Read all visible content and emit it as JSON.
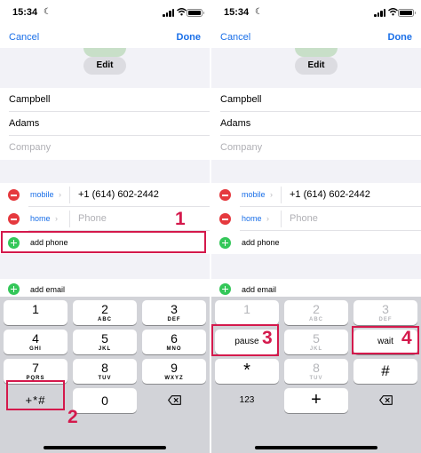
{
  "status_bar": {
    "time": "15:34"
  },
  "nav": {
    "cancel": "Cancel",
    "done": "Done"
  },
  "photo": {
    "edit": "Edit"
  },
  "name_fields": {
    "first": "Campbell",
    "last": "Adams",
    "company_placeholder": "Company"
  },
  "phones": [
    {
      "type": "mobile",
      "value": "+1 (614) 602-2442"
    },
    {
      "type": "home",
      "placeholder": "Phone"
    }
  ],
  "add_phone": "add phone",
  "add_email": "add email",
  "keypad_left": {
    "rows": [
      [
        {
          "num": "1",
          "letters": ""
        },
        {
          "num": "2",
          "letters": "ABC"
        },
        {
          "num": "3",
          "letters": "DEF"
        }
      ],
      [
        {
          "num": "4",
          "letters": "GHI"
        },
        {
          "num": "5",
          "letters": "JKL"
        },
        {
          "num": "6",
          "letters": "MNO"
        }
      ],
      [
        {
          "num": "7",
          "letters": "PQRS"
        },
        {
          "num": "8",
          "letters": "TUV"
        },
        {
          "num": "9",
          "letters": "WXYZ"
        }
      ]
    ],
    "symbols_key": "+*#",
    "zero_key": "0"
  },
  "keypad_right": {
    "top_row": [
      {
        "num": "1",
        "letters": ""
      },
      {
        "num": "2",
        "letters": "ABC"
      },
      {
        "num": "3",
        "letters": "DEF"
      }
    ],
    "pause": "pause",
    "five": {
      "num": "5",
      "letters": "JKL"
    },
    "wait": "wait",
    "star": "*",
    "eight": {
      "num": "8",
      "letters": "TUV"
    },
    "hash": "#",
    "numbers_key": "123",
    "plus_key": "+"
  },
  "callouts": {
    "one": "1",
    "two": "2",
    "three": "3",
    "four": "4"
  },
  "colors": {
    "accent": "#1a6fe8",
    "delete": "#e5393e",
    "add": "#34c759",
    "callout": "#d4194c"
  },
  "icons": [
    "moon-icon",
    "signal-icon",
    "wifi-icon",
    "battery-icon",
    "minus-circle-icon",
    "plus-circle-icon",
    "chevron-right-icon",
    "backspace-icon"
  ]
}
